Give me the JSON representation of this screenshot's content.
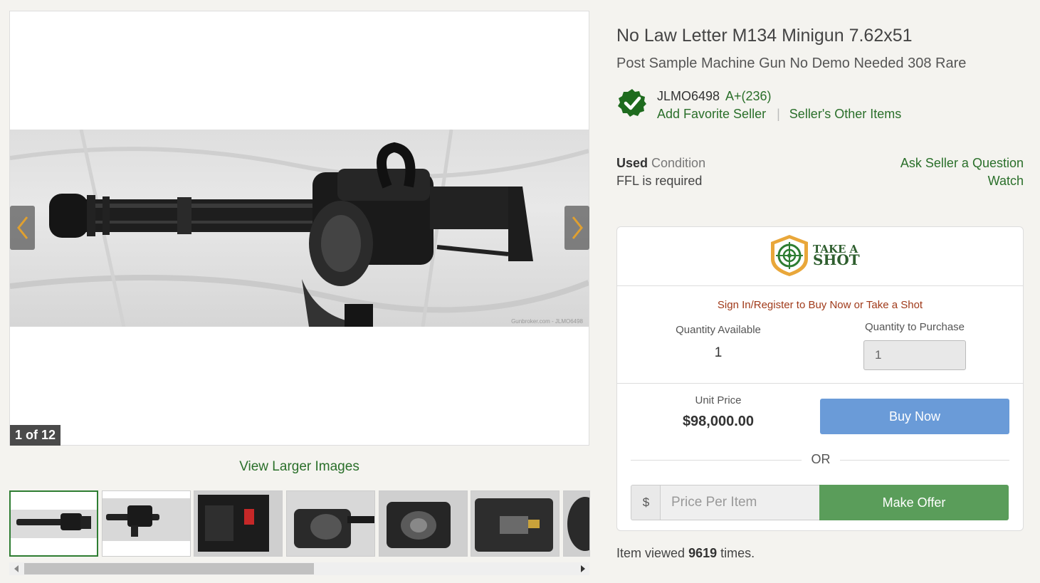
{
  "gallery": {
    "counter": "1 of 12",
    "view_larger_label": "View Larger Images",
    "watermark": "Gunbroker.com - JLMO6498",
    "prev_icon": "chevron-left-icon",
    "next_icon": "chevron-right-icon"
  },
  "listing": {
    "title": "No Law Letter M134 Minigun 7.62x51",
    "subtitle": "Post Sample Machine Gun No Demo Needed 308 Rare"
  },
  "seller": {
    "name": "JLMO6498",
    "rating": "A+(236)",
    "add_favorite": "Add Favorite Seller",
    "separator": "|",
    "other_items": "Seller's Other Items",
    "verified_icon": "verified-check-icon"
  },
  "details": {
    "condition_value": "Used",
    "condition_label": "Condition",
    "ffl": "FFL is required",
    "ask_question": "Ask Seller a Question",
    "watch": "Watch"
  },
  "purchase": {
    "logo_text_line1": "TAKE A",
    "logo_text_line2": "SHOT",
    "signin_text": "Sign In/Register to Buy Now or Take a Shot",
    "qty_available_label": "Quantity Available",
    "qty_available_value": "1",
    "qty_purchase_label": "Quantity to Purchase",
    "qty_purchase_value": "1",
    "unit_price_label": "Unit Price",
    "unit_price_value": "$98,000.00",
    "buy_now_label": "Buy Now",
    "or_label": "OR",
    "currency_symbol": "$",
    "offer_placeholder": "Price Per Item",
    "make_offer_label": "Make Offer"
  },
  "stats": {
    "views_prefix": "Item viewed",
    "views_count": "9619",
    "views_suffix": "times."
  },
  "colors": {
    "accent_green": "#2a6f2a",
    "buy_now_blue": "#6a9bd8",
    "make_offer_green": "#5a9d5a",
    "signin_red": "#a03a1a"
  }
}
